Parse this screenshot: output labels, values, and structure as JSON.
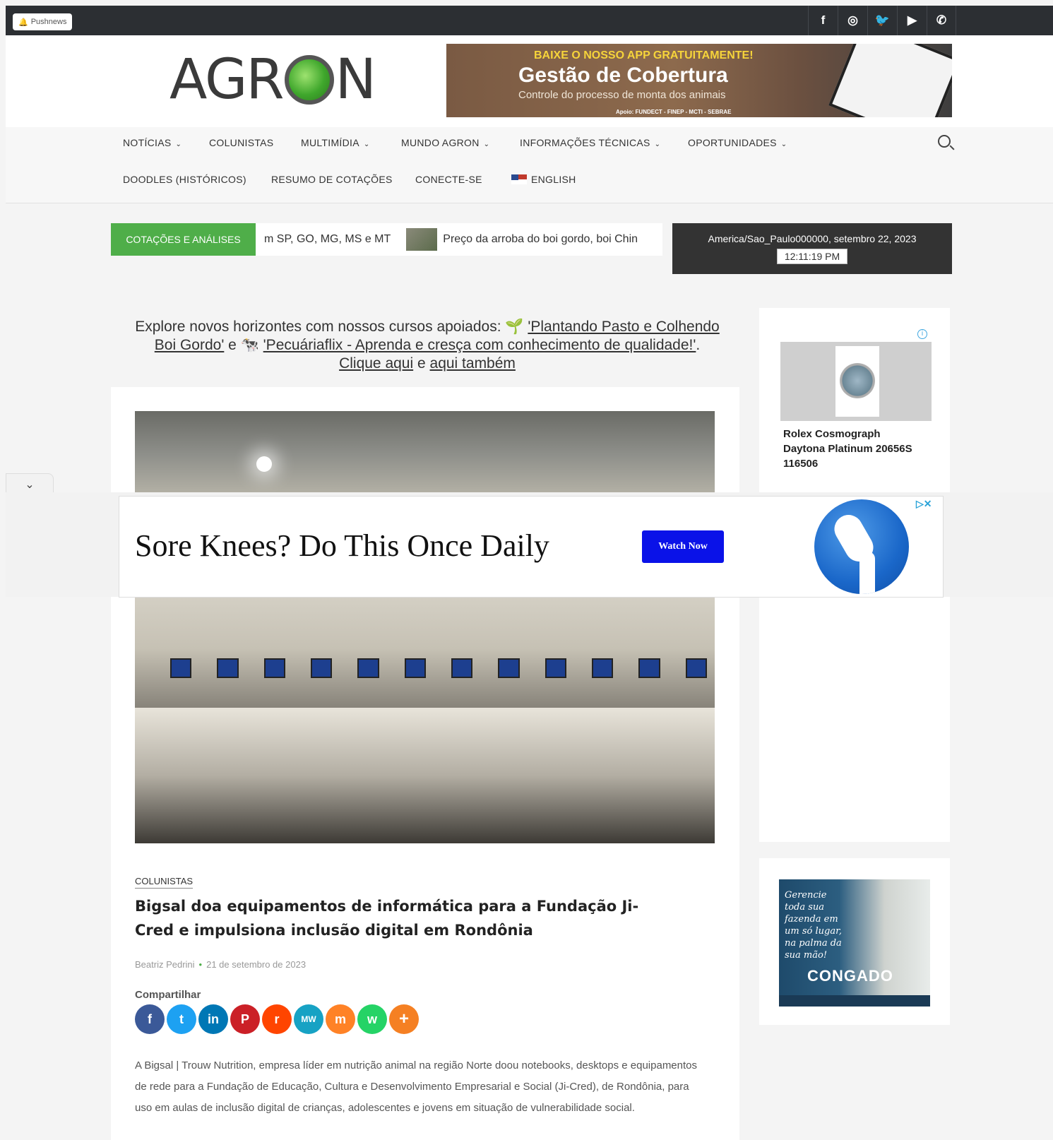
{
  "topbar": {
    "pushnews_label": "Pushnews",
    "social_icons": [
      "facebook-icon",
      "instagram-icon",
      "twitter-icon",
      "youtube-icon",
      "whatsapp-icon"
    ],
    "social_glyphs": [
      "f",
      "◎",
      "🐦",
      "▶",
      "✆"
    ]
  },
  "header": {
    "logo_left": "AGR",
    "logo_right": "N",
    "banner": {
      "top_text": "BAIXE O NOSSO APP GRATUITAMENTE!",
      "main_text": "Gestão de Cobertura",
      "sub_text": "Controle do processo de monta dos animais",
      "footer_text": "Apoio: FUNDECT - FINEP - MCTI - SEBRAE"
    }
  },
  "nav": {
    "row1": [
      "NOTÍCIAS",
      "COLUNISTAS",
      "MULTIMÍDIA",
      "MUNDO AGRON",
      "INFORMAÇÕES TÉCNICAS",
      "OPORTUNIDADES"
    ],
    "row2": [
      "DOODLES (HISTÓRICOS)",
      "RESUMO DE COTAÇÕES",
      "CONECTE-SE",
      "ENGLISH"
    ]
  },
  "ticker": {
    "label": "COTAÇÕES E ANÁLISES",
    "item1": "m SP, GO, MG, MS e MT",
    "item2": "Preço da arroba do boi gordo, boi Chin"
  },
  "clock": {
    "date": "America/Sao_Paulo000000, setembro 22, 2023",
    "time": "12:11:19 PM"
  },
  "promo": {
    "prefix": "Explore novos horizontes com nossos cursos apoiados: 🌱",
    "link1": "'Plantando Pasto e Colhendo Boi Gordo'",
    "mid": " e 🐄 ",
    "link2": "'Pecuáriaflix - Aprenda e cresça com conhecimento de qualidade!'",
    "dot": ". ",
    "link3": "Clique aqui",
    "and": " e ",
    "link4": "aqui também"
  },
  "article": {
    "category": "COLUNISTAS",
    "title": "Bigsal doa equipamentos de informática para a Fundação Ji-Cred e impulsiona inclusão digital em Rondônia",
    "author": "Beatriz Pedrini",
    "date": "21 de setembro de 2023",
    "share_label": "Compartilhar",
    "share_buttons": [
      {
        "name": "facebook",
        "glyph": "f",
        "color": "#3b5998"
      },
      {
        "name": "twitter",
        "glyph": "t",
        "color": "#1da1f2"
      },
      {
        "name": "linkedin",
        "glyph": "in",
        "color": "#0077b5"
      },
      {
        "name": "pinterest",
        "glyph": "P",
        "color": "#cb2027"
      },
      {
        "name": "reddit",
        "glyph": "r",
        "color": "#ff4500"
      },
      {
        "name": "mewe",
        "glyph": "MW",
        "color": "#17a2c4"
      },
      {
        "name": "mix",
        "glyph": "m",
        "color": "#ff8226"
      },
      {
        "name": "whatsapp",
        "glyph": "w",
        "color": "#25d366"
      },
      {
        "name": "more",
        "glyph": "+",
        "color": "#f58023"
      }
    ],
    "body": "A Bigsal | Trouw Nutrition, empresa líder em nutrição animal na região Norte doou notebooks, desktops e equipamentos de rede para a Fundação de Educação, Cultura e Desenvolvimento Empresarial e Social (Ji-Cred), de Rondônia, para uso em aulas de inclusão digital de crianças, adolescentes e jovens em situação de vulnerabilidade social."
  },
  "sidebar": {
    "ad1": {
      "title": "Rolex Cosmograph Daytona Platinum 20656S 116506"
    },
    "ad2": {
      "text": "Gerencie toda sua fazenda em um só lugar, na palma da sua mão!",
      "brand": "CONGADO"
    }
  },
  "overlay_ad": {
    "headline": "Sore Knees? Do This Once Daily",
    "cta": "Watch Now"
  }
}
